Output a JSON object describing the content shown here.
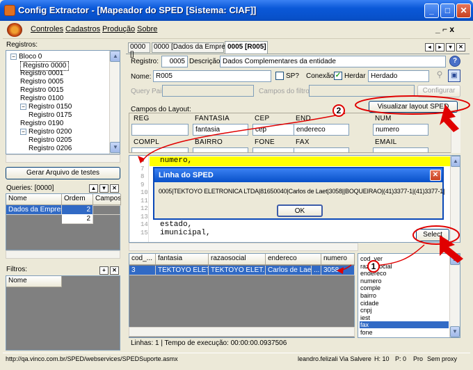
{
  "window": {
    "title": "Config Extractor - [Mapeador do SPED [Sistema: CIAF]]"
  },
  "menu": {
    "items": [
      "Controles",
      "Cadastros",
      "Produção",
      "Sobre"
    ],
    "right_controls": "_ ⌐ x"
  },
  "left": {
    "registros_label": "Registros:",
    "tree": [
      {
        "label": "Bloco 0",
        "level": 0,
        "expander": "−"
      },
      {
        "label": "Registro 0000",
        "level": 1,
        "selected": true
      },
      {
        "label": "Registro 0001",
        "level": 1
      },
      {
        "label": "Registro 0005",
        "level": 1
      },
      {
        "label": "Registro 0015",
        "level": 1
      },
      {
        "label": "Registro 0100",
        "level": 1
      },
      {
        "label": "Registro 0150",
        "level": 1,
        "expander": "−"
      },
      {
        "label": "Registro 0175",
        "level": 2
      },
      {
        "label": "Registro 0190",
        "level": 1
      },
      {
        "label": "Registro 0200",
        "level": 1,
        "expander": "−"
      },
      {
        "label": "Registro 0205",
        "level": 2
      },
      {
        "label": "Registro 0206",
        "level": 2
      }
    ],
    "gerar_button": "Gerar Arquivo de testes",
    "queries_label": "Queries: [0000]",
    "queries_cols": [
      "Nome",
      "Ordem",
      "Campos"
    ],
    "queries_rows": [
      [
        "Dados da Empresa",
        "2",
        ""
      ],
      [
        "",
        "2",
        ""
      ]
    ],
    "filtros_label": "Filtros:",
    "filtros_col": "Nome"
  },
  "tabs": [
    "0000 []",
    "0000 [Dados da Empresa]",
    "0005 [R005]"
  ],
  "form": {
    "registro_label": "Registro:",
    "registro_value": "0005",
    "descricao_label": "Descrição:",
    "descricao_value": "Dados Complementares da entidade",
    "nome_label": "Nome:",
    "nome_value": "R005",
    "sp_label": "SP?",
    "conexao_label": "Conexão:",
    "herdar_label": "Herdar",
    "herdado_value": "Herdado",
    "query_pai_label": "Query Pai:",
    "campos_filtro_label": "Campos do filtro:",
    "configurar_button": "Configurar",
    "campos_layout_label": "Campos do Layout:",
    "visualizar_button": "Visualizar layout SPED"
  },
  "layout_fields": [
    {
      "label": "REG",
      "value": ""
    },
    {
      "label": "FANTASIA",
      "value": "fantasia"
    },
    {
      "label": "CEP",
      "value": "cep"
    },
    {
      "label": "END",
      "value": "endereco"
    },
    {
      "label": "NUM",
      "value": "numero"
    },
    {
      "label": "COMPL",
      "value": ""
    },
    {
      "label": "BAIRRO",
      "value": ""
    },
    {
      "label": "FONE",
      "value": ""
    },
    {
      "label": "FAX",
      "value": ""
    },
    {
      "label": "EMAIL",
      "value": ""
    }
  ],
  "code": {
    "lines": [
      {
        "n": "6",
        "t": "numero,"
      },
      {
        "n": "7",
        "t": ""
      },
      {
        "n": "8",
        "t": ""
      },
      {
        "n": "9",
        "t": ""
      },
      {
        "n": "10",
        "t": ""
      },
      {
        "n": "11",
        "t": ""
      },
      {
        "n": "12",
        "t": ""
      },
      {
        "n": "13",
        "t": ""
      },
      {
        "n": "14",
        "t": "estado,"
      },
      {
        "n": "15",
        "t": "imunicipal,"
      }
    ]
  },
  "dialog": {
    "title": "Linha do SPED",
    "text": "0005|TEKTOYO ELETRONICA LTDA|81650040|Carlos de Laet|3058||BOQUEIRAO|(41)3377-1|(41)3377-1|",
    "ok": "OK"
  },
  "select_button": "Select",
  "results": {
    "cols": [
      "cod_...",
      "fantasia",
      "razaosocial",
      "endereco",
      "numero"
    ],
    "rows": [
      [
        "3",
        "TEKTOYO ELET...",
        "TEKTOYO ELET...",
        "Carlos de Laet",
        "...",
        "3058"
      ]
    ]
  },
  "fields_list": [
    "cod_ver",
    "razaosocial",
    "endereco",
    "numero",
    "comple",
    "bairro",
    "cidade",
    "cnpj",
    "iest",
    "fax",
    "fone"
  ],
  "fields_selected": "fax",
  "exec_status": "Linhas: 1 | Tempo de execução: 00:00:00.0937506",
  "callouts": [
    "1",
    "2"
  ],
  "status": {
    "url": "http://qa.vinco.com.br/SPED/webservices/SPEDSuporte.asmx",
    "user": "leandro.felizali",
    "via": "Via Salvere",
    "h": "H: 10",
    "p": "P: 0",
    "pro": "Pro",
    "proxy": "Sem proxy"
  },
  "colors": {
    "titlebar": "#0a58d8",
    "accent_red": "#e00000",
    "selection": "#316ac5",
    "highlight": "#ffff00"
  }
}
